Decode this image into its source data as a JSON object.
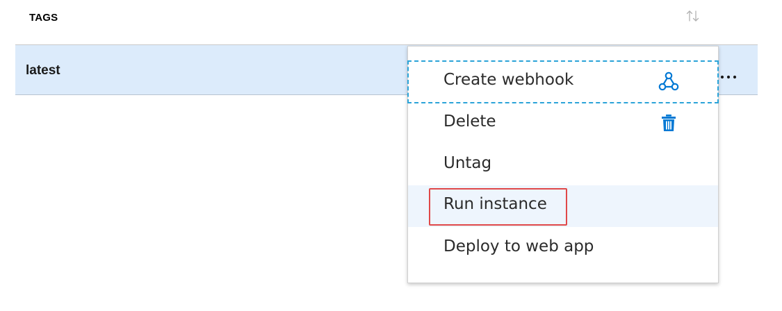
{
  "table": {
    "column_header": "TAGS",
    "sort_icon": "sort-up-down-icon",
    "rows": [
      {
        "tag": "latest",
        "selected": true
      }
    ],
    "row_highlight_color": "#dcebfb"
  },
  "row_actions": {
    "more_icon": "ellipsis-icon",
    "more_glyph": "…"
  },
  "context_menu": {
    "items": [
      {
        "label": "Create webhook",
        "icon": "webhook-icon",
        "focused": true
      },
      {
        "label": "Delete",
        "icon": "trash-icon"
      },
      {
        "label": "Untag"
      },
      {
        "label": "Run instance",
        "hovered": true
      },
      {
        "label": "Deploy to web app"
      }
    ],
    "icon_color": "#0078d4",
    "focus_outline_color": "#2aa3d8"
  },
  "annotation": {
    "highlight_color": "#e04848",
    "highlighted_item": "Run instance"
  }
}
